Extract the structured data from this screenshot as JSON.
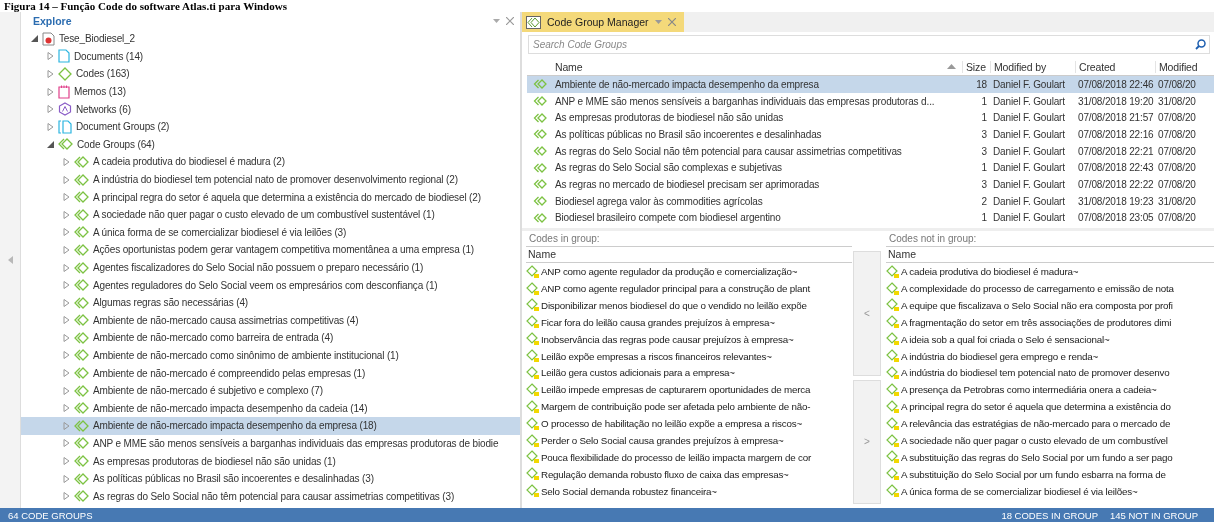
{
  "caption": "Figura 14 – Função Code do software Atlas.ti para Windows",
  "explore": {
    "title": "Explore",
    "tree": [
      {
        "label": "Tese_Biodiesel_2",
        "kind": "project",
        "expanded": true,
        "selected": false,
        "children": [
          {
            "label": "Documents (14)",
            "kind": "document",
            "expanded": false,
            "selected": false
          },
          {
            "label": "Codes (163)",
            "kind": "code",
            "expanded": false,
            "selected": false
          },
          {
            "label": "Memos (13)",
            "kind": "memo",
            "expanded": false,
            "selected": false
          },
          {
            "label": "Networks (6)",
            "kind": "network",
            "expanded": false,
            "selected": false
          },
          {
            "label": "Document Groups (2)",
            "kind": "docgroup",
            "expanded": false,
            "selected": false
          },
          {
            "label": "Code Groups (64)",
            "kind": "codegroup",
            "expanded": true,
            "selected": false,
            "children": [
              {
                "label": "A cadeia produtiva do biodiesel é madura (2)",
                "kind": "codegroup",
                "expanded": false,
                "selected": false
              },
              {
                "label": "A indústria do biodiesel tem potencial nato de promover desenvolvimento regional (2)",
                "kind": "codegroup",
                "expanded": false,
                "selected": false
              },
              {
                "label": "A principal regra do setor é aquela que determina a existência do mercado de biodiesel (2)",
                "kind": "codegroup",
                "expanded": false,
                "selected": false
              },
              {
                "label": "A sociedade não quer pagar o custo elevado de um combustível sustentável (1)",
                "kind": "codegroup",
                "expanded": false,
                "selected": false
              },
              {
                "label": "A única forma de se comercializar biodiesel é via leilões (3)",
                "kind": "codegroup",
                "expanded": false,
                "selected": false
              },
              {
                "label": "Ações oportunistas podem gerar vantagem competitiva momentânea a uma empresa (1)",
                "kind": "codegroup",
                "expanded": false,
                "selected": false
              },
              {
                "label": "Agentes fiscalizadores do Selo Social não possuem o preparo necessário (1)",
                "kind": "codegroup",
                "expanded": false,
                "selected": false
              },
              {
                "label": "Agentes reguladores do Selo Social veem os empresários com desconfiança (1)",
                "kind": "codegroup",
                "expanded": false,
                "selected": false
              },
              {
                "label": "Algumas regras são necessárias (4)",
                "kind": "codegroup",
                "expanded": false,
                "selected": false
              },
              {
                "label": "Ambiente de não-mercado causa assimetrias competitivas (4)",
                "kind": "codegroup",
                "expanded": false,
                "selected": false
              },
              {
                "label": "Ambiente de não-mercado como barreira de entrada (4)",
                "kind": "codegroup",
                "expanded": false,
                "selected": false
              },
              {
                "label": "Ambiente de não-mercado como sinônimo de ambiente institucional (1)",
                "kind": "codegroup",
                "expanded": false,
                "selected": false
              },
              {
                "label": "Ambiente de não-mercado é compreendido pelas empresas (1)",
                "kind": "codegroup",
                "expanded": false,
                "selected": false
              },
              {
                "label": "Ambiente de não-mercado é subjetivo e complexo (7)",
                "kind": "codegroup",
                "expanded": false,
                "selected": false
              },
              {
                "label": "Ambiente de não-mercado impacta desempenho da cadeia (14)",
                "kind": "codegroup",
                "expanded": false,
                "selected": false
              },
              {
                "label": "Ambiente de não-mercado impacta desempenho da empresa (18)",
                "kind": "codegroup",
                "expanded": false,
                "selected": true
              },
              {
                "label": "ANP e MME são menos sensíveis a barganhas individuais das empresas produtoras de biodie",
                "kind": "codegroup",
                "expanded": false,
                "selected": false
              },
              {
                "label": "As empresas produtoras de biodiesel não são unidas (1)",
                "kind": "codegroup",
                "expanded": false,
                "selected": false
              },
              {
                "label": "As políticas públicas no Brasil são incoerentes e desalinhadas (3)",
                "kind": "codegroup",
                "expanded": false,
                "selected": false
              },
              {
                "label": "As regras do Selo Social não têm potencial para causar assimetrias competitivas (3)",
                "kind": "codegroup",
                "expanded": false,
                "selected": false
              }
            ]
          }
        ]
      }
    ]
  },
  "manager": {
    "tab": {
      "title": "Code Group Manager",
      "selected": true
    },
    "search": {
      "placeholder": "Search Code Groups"
    },
    "table": {
      "columns": [
        "Name",
        "Size",
        "Modified by",
        "Created",
        "Modified"
      ],
      "rows": [
        {
          "name": "Ambiente de não-mercado impacta desempenho da empresa",
          "size": "18",
          "modified_by": "Daniel F. Goulart",
          "created": "07/08/2018 22:46",
          "modified": "07/08/20",
          "selected": true
        },
        {
          "name": "ANP e MME são menos sensíveis a barganhas individuais das empresas produtoras d...",
          "size": "1",
          "modified_by": "Daniel F. Goulart",
          "created": "31/08/2018 19:20",
          "modified": "31/08/20",
          "selected": false
        },
        {
          "name": "As empresas produtoras de biodiesel não são unidas",
          "size": "1",
          "modified_by": "Daniel F. Goulart",
          "created": "07/08/2018 21:57",
          "modified": "07/08/20",
          "selected": false
        },
        {
          "name": "As políticas públicas no Brasil são incoerentes e desalinhadas",
          "size": "3",
          "modified_by": "Daniel F. Goulart",
          "created": "07/08/2018 22:16",
          "modified": "07/08/20",
          "selected": false
        },
        {
          "name": "As regras do Selo Social não têm potencial para causar assimetrias competitivas",
          "size": "3",
          "modified_by": "Daniel F. Goulart",
          "created": "07/08/2018 22:21",
          "modified": "07/08/20",
          "selected": false
        },
        {
          "name": "As regras do Selo Social são complexas e subjetivas",
          "size": "1",
          "modified_by": "Daniel F. Goulart",
          "created": "07/08/2018 22:43",
          "modified": "07/08/20",
          "selected": false
        },
        {
          "name": "As regras no mercado de biodiesel precisam ser aprimoradas",
          "size": "3",
          "modified_by": "Daniel F. Goulart",
          "created": "07/08/2018 22:22",
          "modified": "07/08/20",
          "selected": false
        },
        {
          "name": "Biodiesel agrega valor às commodities agrícolas",
          "size": "2",
          "modified_by": "Daniel F. Goulart",
          "created": "31/08/2018 19:23",
          "modified": "31/08/20",
          "selected": false
        },
        {
          "name": "Biodiesel brasileiro compete com biodiesel argentino",
          "size": "1",
          "modified_by": "Daniel F. Goulart",
          "created": "07/08/2018 23:05",
          "modified": "07/08/20",
          "selected": false
        }
      ]
    },
    "in_group": {
      "title": "Codes in group:",
      "column": "Name",
      "items": [
        "ANP como agente regulador da produção e comercialização~",
        "ANP como agente regulador principal para a construção de plant",
        "Disponibilizar menos biodiesel do que o vendido no leilão expõe",
        "Ficar fora do leilão causa grandes prejuízos à empresa~",
        "Inobservância das regras pode causar prejuízos à empresa~",
        "Leilão expõe empresas a riscos financeiros relevantes~",
        "Leilão gera custos adicionais para a empresa~",
        "Leilão impede empresas de capturarem oportunidades de merca",
        "Margem de contribuição pode ser afetada pelo ambiente de não-",
        "O processo de habilitação no leilão expõe a empresa a riscos~",
        "Perder o Selo Social causa grandes prejuízos à empresa~",
        "Pouca flexibilidade do processo de leilão impacta margem de cor",
        "Regulação demanda robusto fluxo de caixa das empresas~",
        "Selo Social demanda robustez financeira~"
      ]
    },
    "transfer_buttons": [
      "<",
      ">"
    ],
    "not_in_group": {
      "title": "Codes not in group:",
      "column": "Name",
      "items": [
        "A cadeia produtiva do biodiesel é madura~",
        "A complexidade do processo de carregamento e emissão de nota",
        "A equipe que fiscalizava o Selo Social não era composta por profi",
        "A fragmentação do setor em três associações de produtores dimi",
        "A ideia sob a qual foi criada o Selo é sensacional~",
        "A indústria do biodiesel gera emprego e renda~",
        "A indústria do biodiesel tem potencial nato de promover desenvo",
        "A presença da Petrobras como intermediária onera a cadeia~",
        "A principal regra do setor é aquela que determina a existência do",
        "A relevância das estratégias de não-mercado para o mercado de",
        "A sociedade não quer pagar o custo elevado de um combustível",
        "A substituição das regras do Selo Social por um fundo a ser pago",
        "A substituição do Selo Social por um fundo esbarra na forma de",
        "A única forma de se comercializar biodiesel é via leilões~"
      ]
    }
  },
  "status_bar": {
    "left": "64 CODE GROUPS",
    "in_group": "18 CODES IN GROUP",
    "not_in_group": "145 NOT IN GROUP"
  }
}
